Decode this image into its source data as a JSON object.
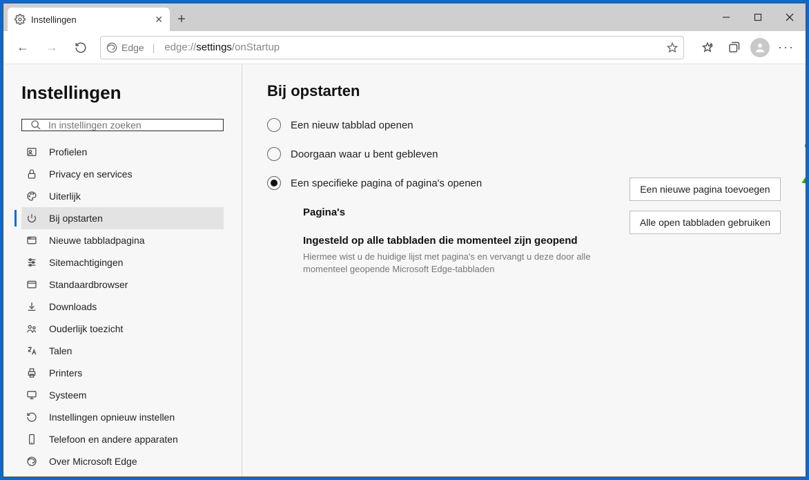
{
  "window": {
    "tab_title": "Instellingen",
    "new_tab_plus": "+"
  },
  "toolbar": {
    "identity_label": "Edge",
    "url_prefix": "edge://",
    "url_highlight": "settings",
    "url_suffix": "/onStartup"
  },
  "sidebar": {
    "title": "Instellingen",
    "search_placeholder": "In instellingen zoeken",
    "items": [
      {
        "label": "Profielen"
      },
      {
        "label": "Privacy en services"
      },
      {
        "label": "Uiterlijk"
      },
      {
        "label": "Bij opstarten"
      },
      {
        "label": "Nieuwe tabbladpagina"
      },
      {
        "label": "Sitemachtigingen"
      },
      {
        "label": "Standaardbrowser"
      },
      {
        "label": "Downloads"
      },
      {
        "label": "Ouderlijk toezicht"
      },
      {
        "label": "Talen"
      },
      {
        "label": "Printers"
      },
      {
        "label": "Systeem"
      },
      {
        "label": "Instellingen opnieuw instellen"
      },
      {
        "label": "Telefoon en andere apparaten"
      },
      {
        "label": "Over Microsoft Edge"
      }
    ]
  },
  "main": {
    "heading": "Bij opstarten",
    "radio_options": [
      {
        "label": "Een nieuw tabblad openen"
      },
      {
        "label": "Doorgaan waar u bent gebleven"
      },
      {
        "label": "Een specifieke pagina of pagina's openen"
      }
    ],
    "selected_index": 2,
    "pages_heading": "Pagina's",
    "set_all_heading": "Ingesteld op alle tabbladen die momenteel zijn geopend",
    "set_all_desc": "Hiermee wist u de huidige lijst met pagina's en vervangt u deze door alle momenteel geopende Microsoft Edge-tabbladen",
    "add_page_button": "Een nieuwe pagina toevoegen",
    "use_open_tabs_button": "Alle open tabbladen gebruiken"
  }
}
